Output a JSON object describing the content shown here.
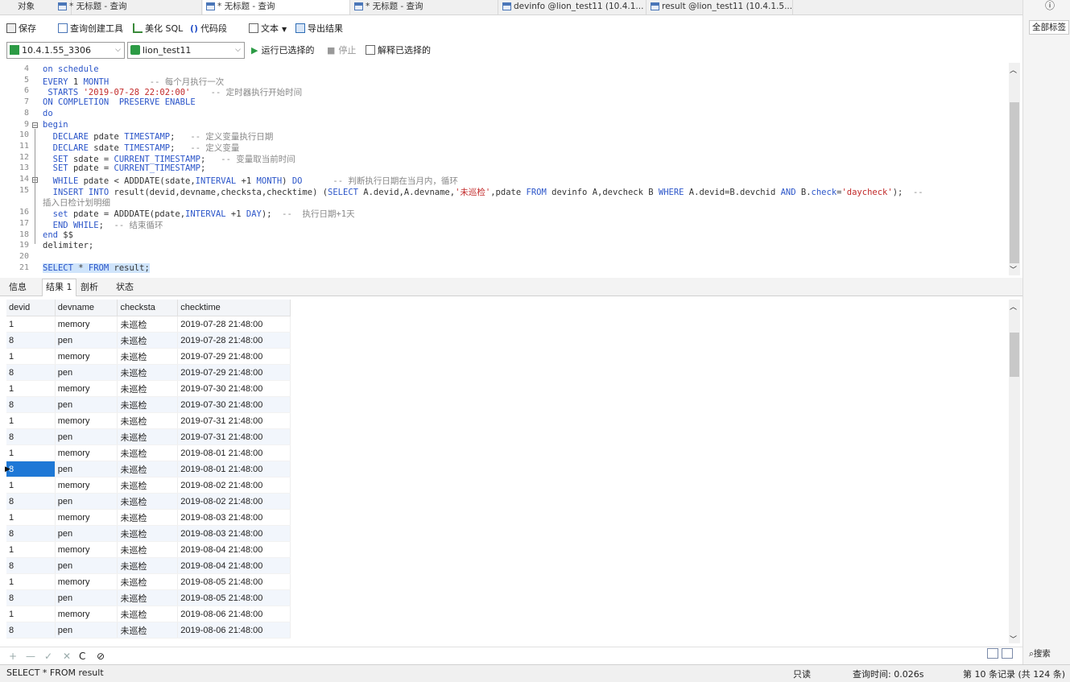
{
  "tabs": [
    {
      "label": "对象",
      "icon": false,
      "active": false
    },
    {
      "label": "* 无标题 - 查询",
      "icon": true,
      "active": false
    },
    {
      "label": "* 无标题 - 查询",
      "icon": true,
      "active": true
    },
    {
      "label": "* 无标题 - 查询",
      "icon": true,
      "active": false
    },
    {
      "label": "devinfo @lion_test11 (10.4.1...",
      "icon": true,
      "active": false
    },
    {
      "label": "result @lion_test11 (10.4.1.5...",
      "icon": true,
      "active": false
    }
  ],
  "right_panel": {
    "all_tags": "全部标签",
    "search": "搜索",
    "info_glyph": "ⓘ"
  },
  "toolbar": {
    "save": "保存",
    "query_builder": "查询创建工具",
    "beautify_sql": "美化 SQL",
    "code_snippet": "代码段",
    "text": "文本",
    "export": "导出结果",
    "connection": "10.4.1.55_3306",
    "database": "lion_test11",
    "run_selected": "运行已选择的",
    "stop": "停止",
    "explain_selected": "解释已选择的"
  },
  "editor_lines": [
    {
      "n": "4",
      "html": "<span class='kw'>on schedule</span>"
    },
    {
      "n": "5",
      "html": "<span class='kw'>EVERY</span> 1 <span class='kw'>MONTH</span>        <span class='cm'>-- 每个月执行一次</span>"
    },
    {
      "n": "6",
      "html": " <span class='kw'>STARTS</span> <span class='str'>'2019-07-28 22:02:00'</span>    <span class='cm'>-- 定时器执行开始时间</span>"
    },
    {
      "n": "7",
      "html": "<span class='kw'>ON COMPLETION  PRESERVE ENABLE</span>"
    },
    {
      "n": "8",
      "html": "<span class='kw'>do</span>"
    },
    {
      "n": "9",
      "html": "<span class='kw'>begin</span>"
    },
    {
      "n": "10",
      "html": "  <span class='kw'>DECLARE</span> pdate <span class='kw'>TIMESTAMP</span>;   <span class='cm'>-- 定义变量执行日期</span>"
    },
    {
      "n": "11",
      "html": "  <span class='kw'>DECLARE</span> sdate <span class='kw'>TIMESTAMP</span>;   <span class='cm'>-- 定义变量</span>"
    },
    {
      "n": "12",
      "html": "  <span class='kw'>SET</span> sdate = <span class='kw'>CURRENT_TIMESTAMP</span>;   <span class='cm'>-- 变量取当前时间</span>"
    },
    {
      "n": "13",
      "html": "  <span class='kw'>SET</span> pdate = <span class='kw'>CURRENT_TIMESTAMP</span>;"
    },
    {
      "n": "14",
      "html": "  <span class='kw'>WHILE</span> pdate &lt; ADDDATE(sdate,<span class='kw'>INTERVAL</span> +1 <span class='kw'>MONTH</span>) <span class='kw'>DO</span>      <span class='cm'>-- 判断执行日期在当月内，循环</span>"
    },
    {
      "n": "15",
      "html": "  <span class='kw'>INSERT INTO</span> result(devid,devname,checksta,checktime) (<span class='kw'>SELECT</span> A.devid,A.devname,<span class='str'>'未巡检'</span>,pdate <span class='kw'>FROM</span> devinfo A,devcheck B <span class='kw'>WHERE</span> A.devid=B.devchid <span class='kw'>AND</span> B.<span class='kw'>check</span>=<span class='str'>'daycheck'</span>);  <span class='cm'>--</span>"
    },
    {
      "n": "",
      "html": "<span class='cm'>插入日检计划明细</span>"
    },
    {
      "n": "16",
      "html": "  <span class='kw'>set</span> pdate = ADDDATE(pdate,<span class='kw'>INTERVAL</span> +1 <span class='kw'>DAY</span>);  <span class='cm'>--  执行日期+1天</span>"
    },
    {
      "n": "17",
      "html": "  <span class='kw'>END WHILE</span>;  <span class='cm'>-- 结束循环</span>"
    },
    {
      "n": "18",
      "html": "<span class='kw'>end</span> $$"
    },
    {
      "n": "19",
      "html": "delimiter;"
    },
    {
      "n": "20",
      "html": ""
    },
    {
      "n": "21",
      "html": "<span style='background:#cfe4fb'><span class='kw'>SELECT</span> * <span class='kw'>FROM</span> result;</span>"
    }
  ],
  "result_tabs": [
    "信息",
    "结果 1",
    "剖析",
    "状态"
  ],
  "grid": {
    "columns": [
      "devid",
      "devname",
      "checksta",
      "checktime"
    ],
    "rows": [
      [
        "1",
        "memory",
        "未巡检",
        "2019-07-28 21:48:00"
      ],
      [
        "8",
        "pen",
        "未巡检",
        "2019-07-28 21:48:00"
      ],
      [
        "1",
        "memory",
        "未巡检",
        "2019-07-29 21:48:00"
      ],
      [
        "8",
        "pen",
        "未巡检",
        "2019-07-29 21:48:00"
      ],
      [
        "1",
        "memory",
        "未巡检",
        "2019-07-30 21:48:00"
      ],
      [
        "8",
        "pen",
        "未巡检",
        "2019-07-30 21:48:00"
      ],
      [
        "1",
        "memory",
        "未巡检",
        "2019-07-31 21:48:00"
      ],
      [
        "8",
        "pen",
        "未巡检",
        "2019-07-31 21:48:00"
      ],
      [
        "1",
        "memory",
        "未巡检",
        "2019-08-01 21:48:00"
      ],
      [
        "8",
        "pen",
        "未巡检",
        "2019-08-01 21:48:00"
      ],
      [
        "1",
        "memory",
        "未巡检",
        "2019-08-02 21:48:00"
      ],
      [
        "8",
        "pen",
        "未巡检",
        "2019-08-02 21:48:00"
      ],
      [
        "1",
        "memory",
        "未巡检",
        "2019-08-03 21:48:00"
      ],
      [
        "8",
        "pen",
        "未巡检",
        "2019-08-03 21:48:00"
      ],
      [
        "1",
        "memory",
        "未巡检",
        "2019-08-04 21:48:00"
      ],
      [
        "8",
        "pen",
        "未巡检",
        "2019-08-04 21:48:00"
      ],
      [
        "1",
        "memory",
        "未巡检",
        "2019-08-05 21:48:00"
      ],
      [
        "8",
        "pen",
        "未巡检",
        "2019-08-05 21:48:00"
      ],
      [
        "1",
        "memory",
        "未巡检",
        "2019-08-06 21:48:00"
      ],
      [
        "8",
        "pen",
        "未巡检",
        "2019-08-06 21:48:00"
      ]
    ],
    "selected_row": 9
  },
  "nav_glyphs": [
    "+",
    "—",
    "✓",
    "✕",
    "C",
    "⊘"
  ],
  "status": {
    "sql": "SELECT * FROM result",
    "readonly": "只读",
    "query_time": "查询时间: 0.026s",
    "records": "第 10 条记录 (共 124 条)"
  },
  "colors": {
    "accent": "#1e78d6",
    "keyword": "#2b55c9",
    "string": "#c22a2a",
    "comment": "#888888"
  }
}
